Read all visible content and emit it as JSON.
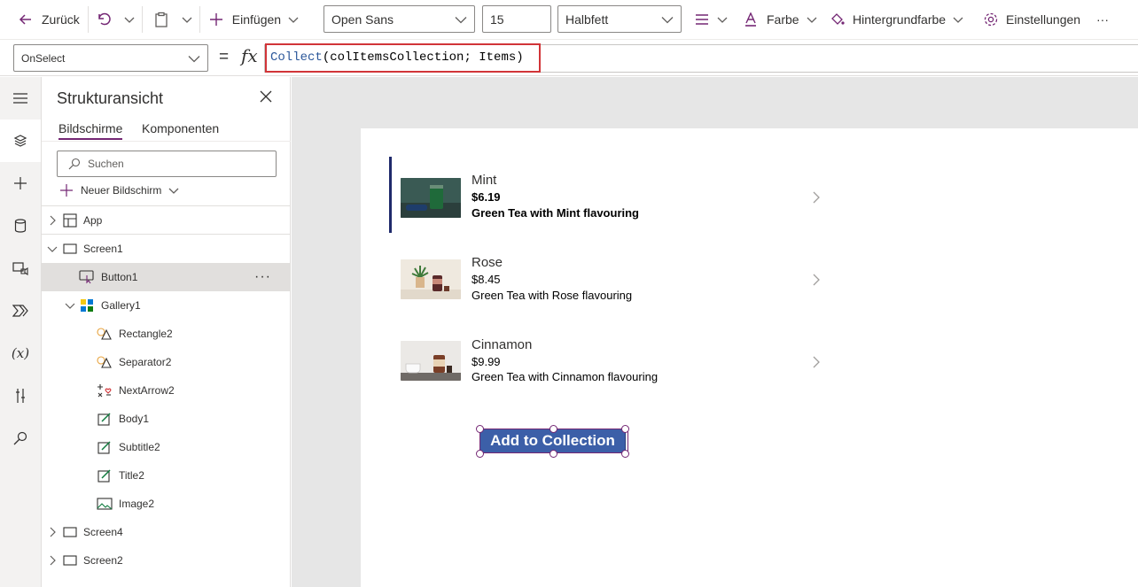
{
  "toolbar": {
    "back_label": "Zurück",
    "insert_label": "Einfügen",
    "font_value": "Open Sans",
    "font_size_value": "15",
    "font_weight_value": "Halbfett",
    "color_label": "Farbe",
    "background_label": "Hintergrundfarbe",
    "settings_label": "Einstellungen",
    "more_label": "···"
  },
  "formula_bar": {
    "property_value": "OnSelect",
    "equals": "=",
    "fx": "fx",
    "formula_keyword": "Collect",
    "formula_rest": "(colItemsCollection; Items)"
  },
  "tree_view": {
    "title": "Strukturansicht",
    "tabs": [
      "Bildschirme",
      "Komponenten"
    ],
    "search_placeholder": "Suchen",
    "new_screen_label": "Neuer Bildschirm",
    "nodes": [
      {
        "label": "App",
        "icon": "app-icon"
      },
      {
        "label": "Screen1",
        "icon": "screen-icon"
      },
      {
        "label": "Button1",
        "icon": "button-icon"
      },
      {
        "label": "Gallery1",
        "icon": "gallery-icon"
      },
      {
        "label": "Rectangle2",
        "icon": "shape-icon"
      },
      {
        "label": "Separator2",
        "icon": "shape-icon"
      },
      {
        "label": "NextArrow2",
        "icon": "icons-icon"
      },
      {
        "label": "Body1",
        "icon": "label-icon"
      },
      {
        "label": "Subtitle2",
        "icon": "label-icon"
      },
      {
        "label": "Title2",
        "icon": "label-icon"
      },
      {
        "label": "Image2",
        "icon": "image-icon"
      },
      {
        "label": "Screen4",
        "icon": "screen-icon"
      },
      {
        "label": "Screen2",
        "icon": "screen-icon"
      }
    ],
    "more_label": "···"
  },
  "gallery": {
    "items": [
      {
        "title": "Mint",
        "price": "$6.19",
        "body": "Green Tea with Mint flavouring"
      },
      {
        "title": "Rose",
        "price": "$8.45",
        "body": "Green Tea with Rose flavouring"
      },
      {
        "title": "Cinnamon",
        "price": "$9.99",
        "body": "Green Tea with Cinnamon flavouring"
      }
    ]
  },
  "canvas_button": {
    "label": "Add to Collection"
  },
  "colors": {
    "accent_purple": "#742774",
    "formula_highlight": "#d13438",
    "button_blue": "#3c5fa8",
    "gallery_accent": "#1f2a6b"
  }
}
